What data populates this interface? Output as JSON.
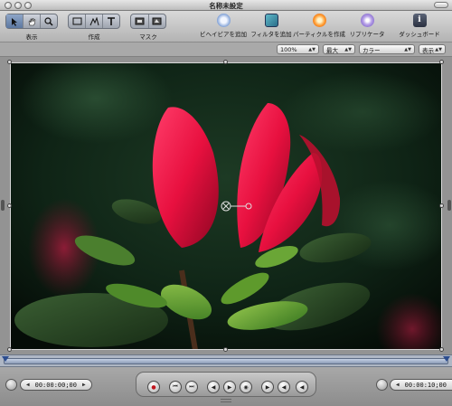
{
  "window": {
    "title": "名称未設定"
  },
  "toolbar": {
    "groups": [
      {
        "label": "表示",
        "tools": [
          "arrow",
          "hand",
          "zoom"
        ]
      },
      {
        "label": "作成",
        "tools": [
          "rectangle",
          "bezier",
          "text"
        ]
      },
      {
        "label": "マスク",
        "tools": [
          "rect-mask",
          "bezier-mask"
        ]
      }
    ],
    "actions": [
      {
        "label": "ビヘイビアを追加",
        "icon": "gear-icon"
      },
      {
        "label": "フィルタを追加",
        "icon": "filter-icon"
      },
      {
        "label": "パーティクルを作成",
        "icon": "particle-icon"
      },
      {
        "label": "リプリケータ",
        "icon": "replicator-icon"
      },
      {
        "label": "ダッシュボード",
        "icon": "info-icon"
      }
    ]
  },
  "options": {
    "zoom": "100%",
    "quality": "最大",
    "channels": "カラー",
    "view": "表示"
  },
  "transport": {
    "current_time": "00:00:00;00",
    "end_time": "00:00:10;00"
  },
  "colors": {
    "accent": "#2c4d8f",
    "photo_bg": "#0c1810"
  }
}
